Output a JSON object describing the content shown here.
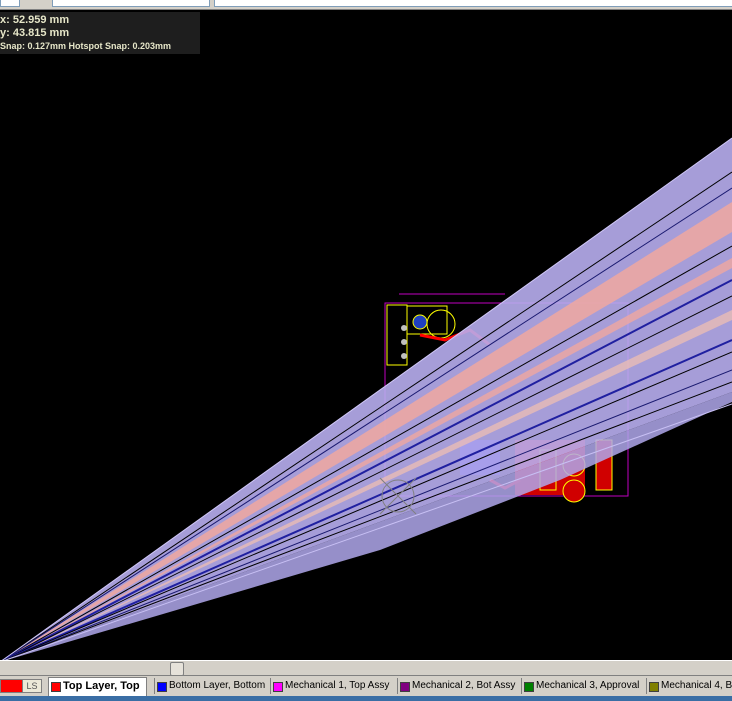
{
  "hud": {
    "x_readout": "x: 52.959 mm",
    "y_readout": "y: 43.815 mm",
    "snap_readout": "Snap: 0.127mm Hotspot Snap: 0.203mm"
  },
  "layer_bar": {
    "current_layer_color": "#ff0000",
    "ls_label": "LS",
    "tabs": [
      {
        "label": "Top Layer, Top",
        "color": "#ff0000",
        "active": true
      },
      {
        "label": "Bottom Layer, Bottom",
        "color": "#0000ff",
        "active": false
      },
      {
        "label": "Mechanical 1, Top Assy",
        "color": "#ff00ff",
        "active": false
      },
      {
        "label": "Mechanical 2, Bot Assy",
        "color": "#800080",
        "active": false
      },
      {
        "label": "Mechanical 3, Approval",
        "color": "#008000",
        "active": false
      },
      {
        "label": "Mechanical 4, B",
        "color": "#808000",
        "active": false
      }
    ]
  },
  "colors": {
    "canvas_background": "#000000",
    "ratsnest_lavender": "#b8aef0",
    "ratsnest_salmon": "#f0a8a0",
    "ratsnest_blue": "#2020a0",
    "board_outline_magenta": "#c000c0",
    "silkscreen_yellow": "#ffff00",
    "top_copper_red": "#ff0000",
    "bottom_copper_blue": "#0000ff"
  },
  "icons": {
    "origin_marker": "crosshair-circle-icon",
    "ls_toggle": "layer-set-icon"
  }
}
